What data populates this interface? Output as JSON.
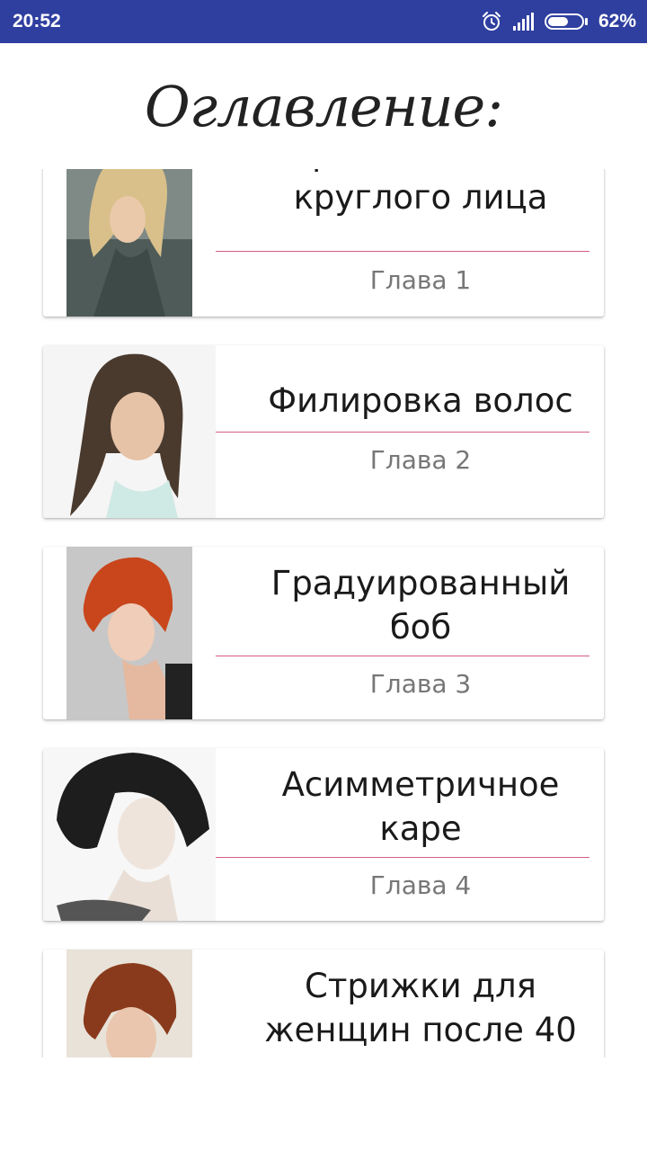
{
  "status_bar": {
    "time": "20:52",
    "battery_percent": "62%",
    "battery_level": 0.62,
    "icons": [
      "alarm-icon",
      "signal-icon",
      "battery-icon"
    ]
  },
  "header": {
    "title": "Оглавление:"
  },
  "chapters": [
    {
      "title": "Стрижка боб для круглого лица",
      "chapter_label": "Глава 1"
    },
    {
      "title": "Филировка волос",
      "chapter_label": "Глава 2"
    },
    {
      "title": "Градуированный боб",
      "chapter_label": "Глава 3"
    },
    {
      "title": "Асимметричное каре",
      "chapter_label": "Глава 4"
    },
    {
      "title": "Стрижки для женщин после 40",
      "chapter_label": ""
    }
  ],
  "colors": {
    "status_bar": "#2f3f9f",
    "divider": "#c2185b"
  }
}
